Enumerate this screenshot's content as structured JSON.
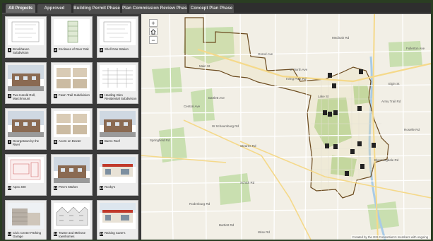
{
  "tabs": [
    {
      "label": "All Projects",
      "active": true
    },
    {
      "label": "Approved",
      "active": false
    },
    {
      "label": "Building Permit Phase",
      "active": false
    },
    {
      "label": "Plan Commission Review Phase",
      "active": false
    },
    {
      "label": "Concept Plan Phase",
      "active": false
    }
  ],
  "projects": [
    {
      "num": "1",
      "label": "Brookhaven Subdivision",
      "thumb": "site-plan"
    },
    {
      "num": "2",
      "label": "Enclaves of Deer Oak",
      "thumb": "lot-map"
    },
    {
      "num": "3",
      "label": "Shell Gas Station",
      "thumb": "site-plan"
    },
    {
      "num": "4",
      "label": "Two Harold Roll, Marchmount",
      "thumb": "building"
    },
    {
      "num": "5",
      "label": "Fawn Trail Subdivision",
      "thumb": "elevations"
    },
    {
      "num": "6",
      "label": "Harding Glen Residential Subdivision",
      "thumb": "drawing"
    },
    {
      "num": "7",
      "label": "Georgetown by the River",
      "thumb": "building"
    },
    {
      "num": "8",
      "label": "Acorn on Dexter",
      "thumb": "elevations"
    },
    {
      "num": "9",
      "label": "Burns Reef",
      "thumb": "building"
    },
    {
      "num": "10",
      "label": "Apex 400",
      "thumb": "site-plan-red"
    },
    {
      "num": "11",
      "label": "Pete's Market",
      "thumb": "building"
    },
    {
      "num": "12",
      "label": "Rocky's",
      "thumb": "storefront"
    },
    {
      "num": "13",
      "label": "Civic Center Parking Garage",
      "thumb": "garage"
    },
    {
      "num": "14",
      "label": "Towne and Melrose townhomes",
      "thumb": "townhomes"
    },
    {
      "num": "15",
      "label": "Raising Cane's",
      "thumb": "storefront"
    }
  ],
  "map": {
    "zoom_in": "+",
    "zoom_out": "−",
    "home_icon": "home-icon",
    "attribution": "Created by the GIS Consortium's members with ongoing"
  },
  "street_labels": [
    "Fullerton Ave",
    "W North Ave",
    "Grand Ave",
    "Main St",
    "Irving Park Rd",
    "Lake St",
    "Army Trail Rd",
    "Stearns Rd",
    "Bloomingdale Rd",
    "Schick Rd",
    "Roselle Rd",
    "Rodenburg Rd",
    "Springfield Rd",
    "Bartlett Rd",
    "Wise Rd",
    "Central Ave",
    "W Schaumburg Rd",
    "Bartlett Ave",
    "Medinah Rd",
    "Elgin St"
  ],
  "colors": {
    "boundary": "#6b4a1e",
    "marker": "#222222",
    "park": "#b8d69a",
    "highway": "#f5d98a",
    "water": "#a9cbe6"
  }
}
